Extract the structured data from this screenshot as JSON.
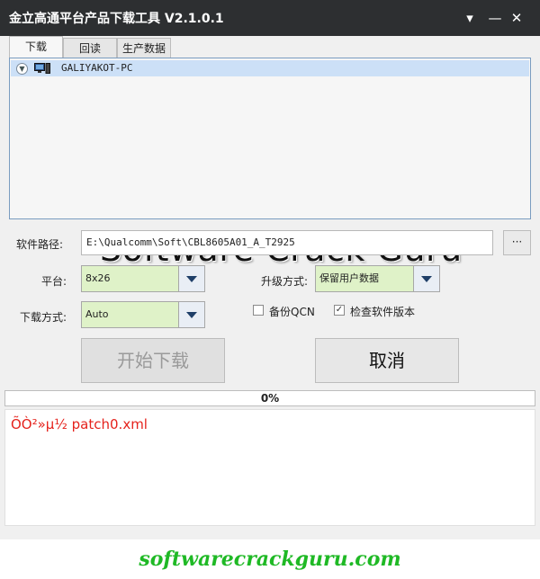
{
  "window": {
    "title": "金立高通平台产品下载工具 V2.1.0.1",
    "buttons": {
      "menu": "▾",
      "minimize": "—",
      "close": "✕"
    }
  },
  "tabs": [
    {
      "label": "下载",
      "active": true
    },
    {
      "label": "回读",
      "active": false
    },
    {
      "label": "生产数据",
      "active": false
    }
  ],
  "device_tree": {
    "items": [
      {
        "label": "GALIYAKOT-PC"
      }
    ]
  },
  "watermark": "Software Crack Guru",
  "form": {
    "software_path_label": "软件路径:",
    "software_path_value": "E:\\Qualcomm\\Soft\\CBL8605A01_A_T2925",
    "browse_label": "···",
    "platform_label": "平台:",
    "platform_value": "8x26",
    "upgrade_label": "升级方式:",
    "upgrade_value": "保留用户数据",
    "download_mode_label": "下载方式:",
    "download_mode_value": "Auto",
    "backup_qcn_label": "备份QCN",
    "backup_qcn_checked": false,
    "check_software_label": "检查软件版本",
    "check_software_checked": true
  },
  "actions": {
    "start_label": "开始下载",
    "cancel_label": "取消"
  },
  "progress": {
    "value": 0,
    "text": "0%"
  },
  "log": {
    "lines": [
      "ÕÒ²»µ½ patch0.xml"
    ]
  },
  "footer": {
    "url_text": "softwarecrackguru.com"
  },
  "colors": {
    "titlebar": "#2d2f31",
    "combo_bg": "#dff2c8",
    "log_text": "#e5221c",
    "footer_text": "#1fb925"
  }
}
